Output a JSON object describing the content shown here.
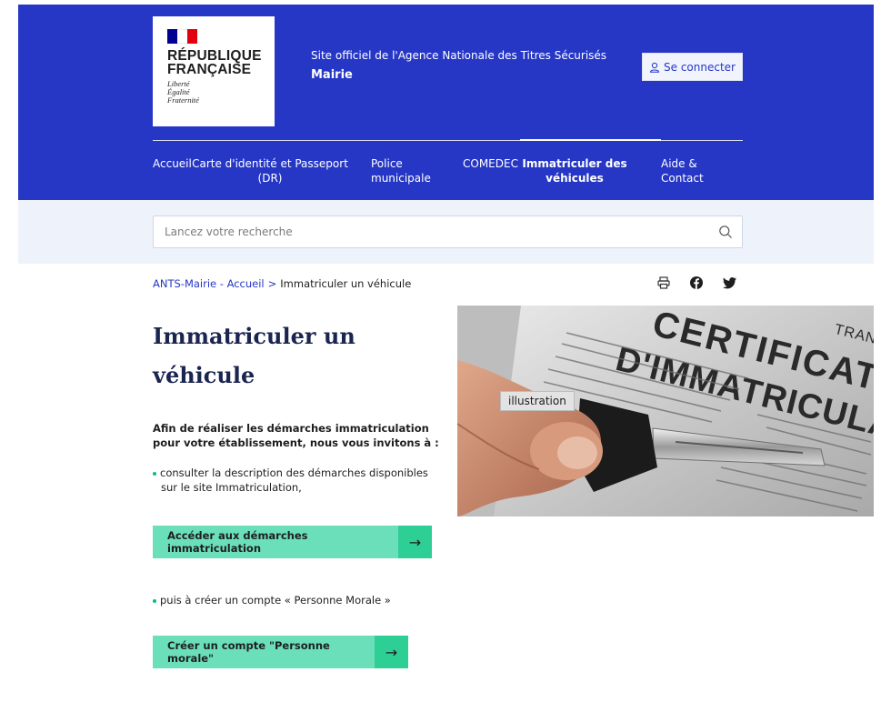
{
  "header": {
    "logo": {
      "title_line1": "RÉPUBLIQUE",
      "title_line2": "FRANÇAISE",
      "motto1": "Liberté",
      "motto2": "Égalité",
      "motto3": "Fraternité"
    },
    "site_tagline": "Site officiel de l'Agence Nationale des Titres Sécurisés",
    "site_name": "Mairie",
    "connect_label": "Se connecter",
    "nav": {
      "accueil": "Accueil",
      "cni": "Carte d'identité et Passeport (DR)",
      "police": "Police municipale",
      "comedec": "COMEDEC",
      "immat": "Immatriculer des véhicules",
      "aide": "Aide & Contact"
    }
  },
  "search": {
    "placeholder": "Lancez votre recherche"
  },
  "breadcrumb": {
    "home": "ANTS-Mairie - Accueil",
    "separator": ">",
    "current": "Immatriculer un véhicule"
  },
  "content": {
    "title": "Immatriculer un véhicule",
    "intro": "Afin de réaliser les démarches immatriculation pour votre établissement, nous vous invitons à :",
    "bullet1_line1": "consulter la description des démarches disponibles",
    "bullet1_line2": "sur le site Immatriculation,",
    "cta1": "Accéder aux démarches immatriculation",
    "bullet2": "puis à créer un compte « Personne Morale »",
    "cta2": "Créer un compte \"Personne morale\"",
    "arrow": "→"
  },
  "illustration": {
    "tag": "illustration",
    "doc_text1": "CERTIFICAT",
    "doc_text2": "D'IMMATRICULATION",
    "doc_text3": "TRANSPORTS"
  },
  "colors": {
    "brand_blue": "#2637c6",
    "cta_green": "#6adfba",
    "cta_green_dark": "#2dcf95",
    "search_band": "#eef2fa"
  }
}
